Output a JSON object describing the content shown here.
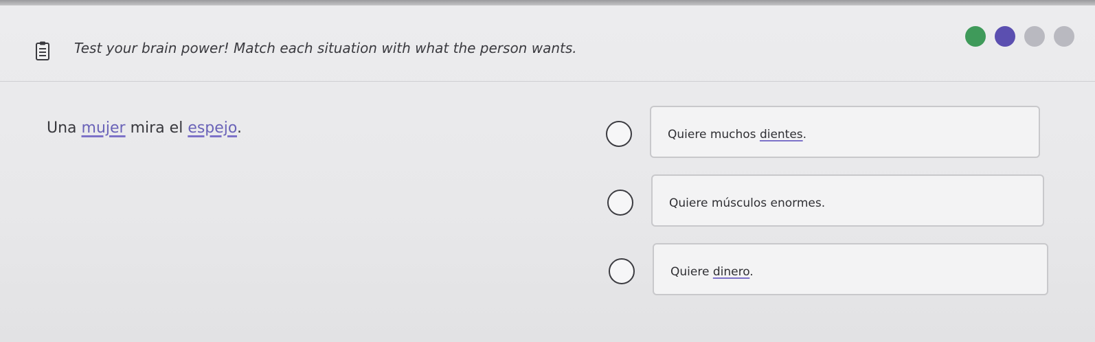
{
  "header": {
    "icon": "clipboard-icon",
    "instruction": "Test your brain power! Match each situation with what the person wants."
  },
  "progress": {
    "dots": [
      {
        "state": "complete",
        "color": "#3f9a5a"
      },
      {
        "state": "current",
        "color": "#5b4fb0"
      },
      {
        "state": "pending",
        "color": "#b9b9c0"
      },
      {
        "state": "pending",
        "color": "#b9b9c0"
      }
    ]
  },
  "question": {
    "parts": [
      "Una ",
      "mujer",
      " mira el ",
      "espejo",
      "."
    ]
  },
  "options": [
    {
      "parts": [
        "Quiere muchos ",
        "dientes",
        "."
      ]
    },
    {
      "parts": [
        "Quiere músculos enormes."
      ]
    },
    {
      "parts": [
        "Quiere ",
        "dinero",
        "."
      ]
    }
  ],
  "colors": {
    "vocab_underline": "#7c71c8",
    "complete": "#3f9a5a",
    "current": "#5b4fb0",
    "pending": "#b9b9c0"
  }
}
